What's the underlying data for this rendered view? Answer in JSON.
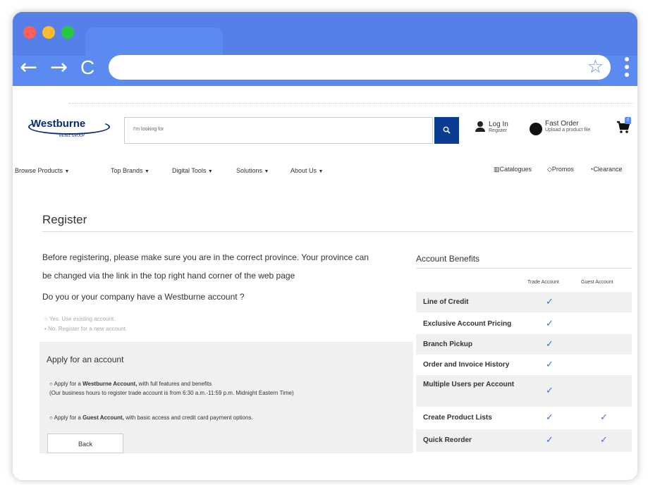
{
  "browser": {
    "url": "",
    "nav": {
      "back": "←",
      "forward": "→",
      "reload": "C"
    },
    "star_icon": "☆",
    "colors": {
      "chrome": "#5b8bf0",
      "close": "#ff5f57",
      "minimize": "#febc2e",
      "maximize": "#28c840"
    }
  },
  "header": {
    "logo_text": "Westburne",
    "logo_sub": "REXEL GROUP",
    "search_placeholder": "I'm looking for",
    "login_label": "Log In",
    "register_label": "Register",
    "fast_order_label": "Fast Order",
    "fast_order_sub": "Upload a product file",
    "cart_count": "0"
  },
  "menu": {
    "items": [
      "Browse Products",
      "Top Brands",
      "Digital Tools",
      "Solutions",
      "About Us"
    ],
    "utility": [
      "Catalogues",
      "Promos",
      "Clearance"
    ]
  },
  "register": {
    "title": "Register",
    "intro_line1": "Before registering, please make sure you are in the correct province. Your province can",
    "intro_line2": "be changed via the link in the top right hand corner of the web page",
    "question": "Do you or your company have a Westburne account ?",
    "option_yes": "Yes. Use existing account.",
    "option_no": "No. Register for a new account."
  },
  "apply": {
    "title": "Apply for an account",
    "opt1_pre": "Apply for a ",
    "opt1_bold": "Westburne Account,",
    "opt1_post": " with full features and benefits",
    "opt1_note": "(Our business hours to register trade account is from 6:30 a.m.-11:59 p.m. Midnight Eastern Time)",
    "opt2_pre": "Apply for a ",
    "opt2_bold": "Guest Account,",
    "opt2_post": " with basic access and credit card payment options.",
    "back_label": "Back"
  },
  "benefits": {
    "title": "Account Benefits",
    "col_trade": "Trade Account",
    "col_guest": "Guest Account",
    "check": "✓",
    "rows": [
      {
        "name": "Line of Credit",
        "trade": true,
        "guest": false
      },
      {
        "name": "Exclusive Account Pricing",
        "trade": true,
        "guest": false
      },
      {
        "name": "Branch Pickup",
        "trade": true,
        "guest": false
      },
      {
        "name": "Order and Invoice History",
        "trade": true,
        "guest": false
      },
      {
        "name": "Multiple Users per Account",
        "trade": true,
        "guest": false
      },
      {
        "name": "Create Product Lists",
        "trade": true,
        "guest": true
      },
      {
        "name": "Quick Reorder",
        "trade": true,
        "guest": true
      }
    ]
  }
}
